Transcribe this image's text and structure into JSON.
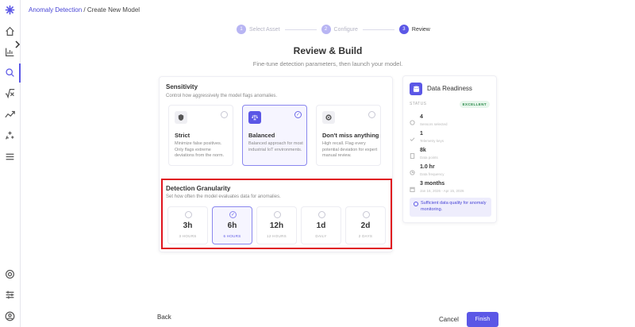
{
  "breadcrumb": {
    "parent": "Anomaly Detection",
    "separator": " / ",
    "current": "Create New Model"
  },
  "stepper": [
    {
      "num": "1",
      "label": "Select Asset"
    },
    {
      "num": "2",
      "label": "Configure"
    },
    {
      "num": "3",
      "label": "Review"
    }
  ],
  "header": {
    "title": "Review & Build",
    "subtitle": "Fine-tune detection parameters, then launch your model."
  },
  "sensitivity": {
    "title": "Sensitivity",
    "desc": "Control how aggressively the model flags anomalies.",
    "options": [
      {
        "name": "Strict",
        "desc": "Minimize false positives. Only flags extreme deviations from the norm.",
        "icon": "shield-icon",
        "selected": false
      },
      {
        "name": "Balanced",
        "desc": "Balanced approach for most industrial IoT environments.",
        "icon": "scale-icon",
        "selected": true
      },
      {
        "name": "Don't miss anything",
        "desc": "High recall. Flag every potential deviation for expert manual review.",
        "icon": "target-icon",
        "selected": false
      }
    ]
  },
  "granularity": {
    "title": "Detection Granularity",
    "desc": "Set how often the model evaluates data for anomalies.",
    "options": [
      {
        "value": "3h",
        "sub": "3 HOURS",
        "selected": false
      },
      {
        "value": "6h",
        "sub": "6 HOURS",
        "selected": true
      },
      {
        "value": "12h",
        "sub": "12 HOURS",
        "selected": false
      },
      {
        "value": "1d",
        "sub": "DAILY",
        "selected": false
      },
      {
        "value": "2d",
        "sub": "2 DAYS",
        "selected": false
      }
    ]
  },
  "readiness": {
    "title": "Data Readiness",
    "status_label": "STATUS",
    "status": "EXCELLENT",
    "metrics": [
      {
        "value": "4",
        "label": "Sensors selected"
      },
      {
        "value": "1",
        "label": "Telemetry keys"
      },
      {
        "value": "8k",
        "label": "Data points"
      },
      {
        "value": "1.0 hr",
        "label": "Data frequency"
      },
      {
        "value": "3 months",
        "label": "Jan 16, 2026 - Apr 15, 2026"
      }
    ],
    "note": "Sufficient data quality for anomaly monitoring."
  },
  "footer": {
    "back": "Back",
    "cancel": "Cancel",
    "finish": "Finish"
  }
}
